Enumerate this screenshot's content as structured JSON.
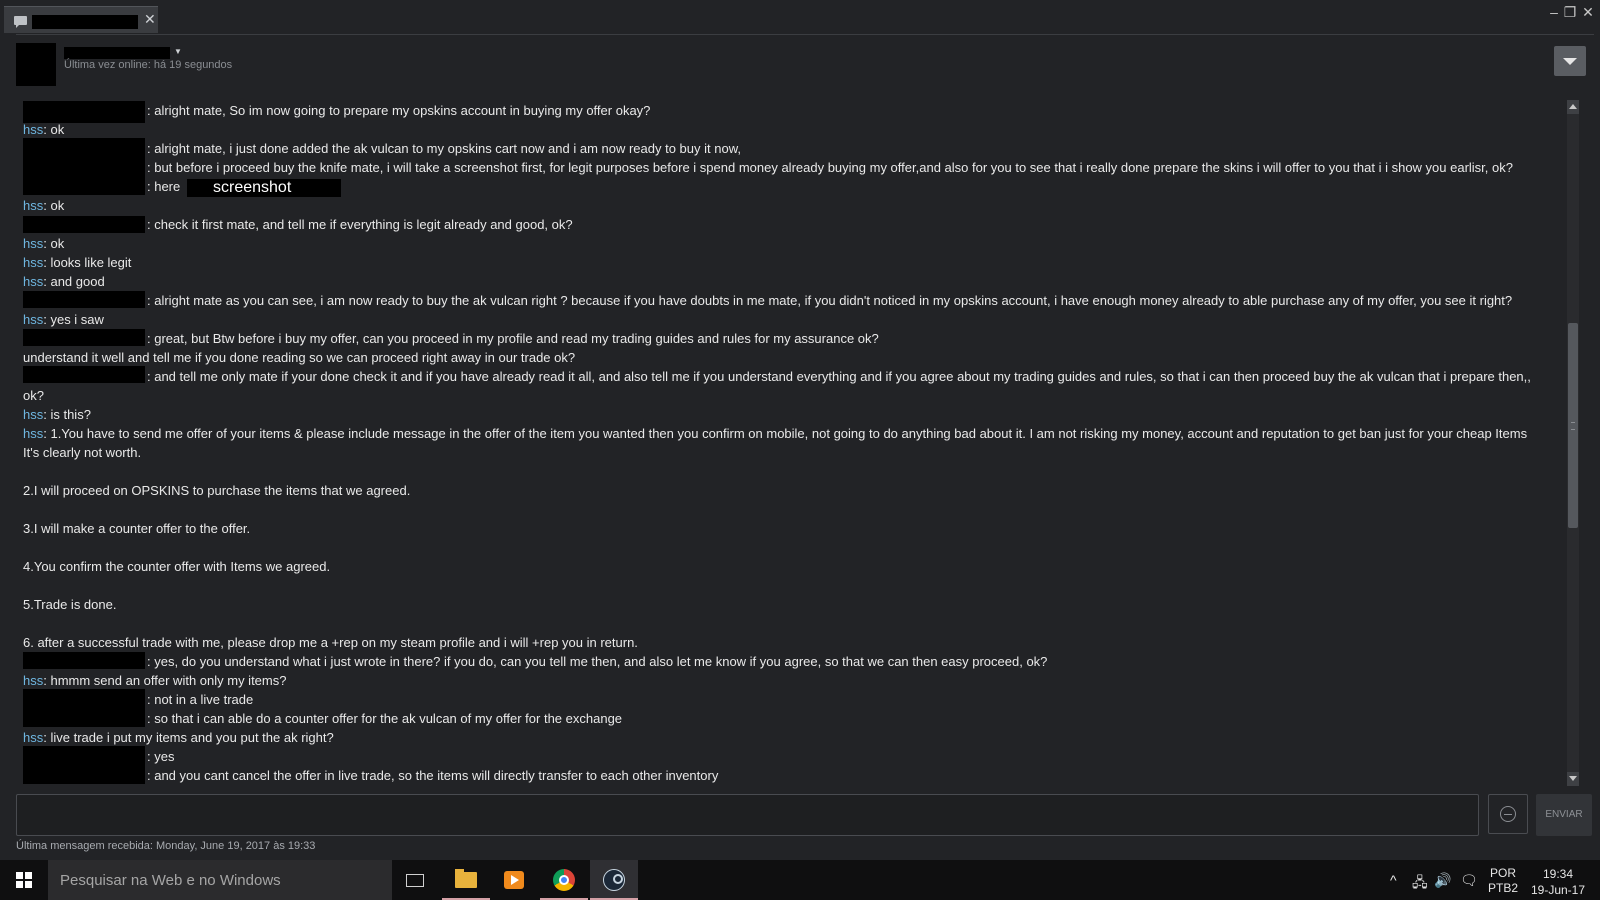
{
  "window": {
    "minimize_glyph": "–",
    "restore_glyph": "❐",
    "close_glyph": "✕",
    "tab_close_glyph": "✕"
  },
  "header": {
    "status": "Última vez online: há 19 segundos",
    "menu_icon": "chevron-down-icon"
  },
  "chat": {
    "screenshot_link": "screenshot",
    "lines": [
      {
        "nick": "",
        "text": ": alright mate,  So im now going to prepare my opskins account in buying my offer okay?"
      },
      {
        "nick": "hss",
        "text": ": ok"
      },
      {
        "nick": "",
        "text": ": alright mate,  i just done added the ak vulcan to my opskins cart now and i am now ready to buy it now,"
      },
      {
        "nick": "",
        "text": ": but before i proceed buy the knife mate,  i will take a screenshot first, for legit purposes before i spend money already buying my offer,and also for you to see that i really done prepare the skins i will offer to you  that i i show you earlisr,  ok?"
      },
      {
        "nick": "",
        "text": ": here"
      },
      {
        "nick": "hss",
        "text": ": ok"
      },
      {
        "nick": "",
        "text": ": check it first mate,  and tell me if everything is legit already and good,  ok?"
      },
      {
        "nick": "hss",
        "text": ": ok"
      },
      {
        "nick": "hss",
        "text": ": looks like legit"
      },
      {
        "nick": "hss",
        "text": ": and good"
      },
      {
        "nick": "",
        "text": ": alright mate  as you can see,  i am now ready to buy the ak vulcan right ?  because if you have doubts in me mate,  if you didn't noticed in my opskins account,  i have enough money already  to able purchase any of my offer,  you see it  right?"
      },
      {
        "nick": "hss",
        "text": ": yes i saw"
      },
      {
        "nick": "",
        "text": ": great,  but Btw before i buy my offer, can you proceed in my profile and read my trading guides and rules for my assurance ok?"
      },
      {
        "nick": "",
        "text": "understand it well and tell me if you done reading so we can proceed right away in our trade ok?"
      },
      {
        "nick": "",
        "text": ": and tell me only mate if your done check it and if you have already read it all,  and also tell me if you understand everything and if you agree about my trading guides and rules,  so that i can then proceed buy the ak vulcan that i prepare then,,"
      },
      {
        "nick": "",
        "text": "ok?"
      },
      {
        "nick": "hss",
        "text": ": is this?"
      },
      {
        "nick": "hss",
        "text": ": 1.You have to send me offer of your items & please include message in the offer of the item you wanted then you confirm on mobile, not going to do anything bad about it. I am not risking my money, account and reputation to get ban just for your cheap Items"
      },
      {
        "nick": "",
        "text": "It's clearly not worth."
      },
      {
        "nick": "",
        "text": "2.I will proceed on OPSKINS to purchase the items that we agreed."
      },
      {
        "nick": "",
        "text": "3.I will make a counter offer to the offer."
      },
      {
        "nick": "",
        "text": "4.You confirm the counter offer with Items we agreed."
      },
      {
        "nick": "",
        "text": "5.Trade is done."
      },
      {
        "nick": "",
        "text": "6. after a successful trade with me, please drop me a +rep on my steam profile and i will +rep you in return."
      },
      {
        "nick": "",
        "text": ": yes,  do you understand  what i just wrote in there?  if you do,  can you tell me then, and also let me know if you agree,  so that we can then easy proceed,  ok?"
      },
      {
        "nick": "hss",
        "text": ": hmmm send an offer with only my items?"
      },
      {
        "nick": "",
        "text": ": not in a live trade"
      },
      {
        "nick": "",
        "text": ": so that i can able do a counter offer  for the ak vulcan of my offer for the exchange"
      },
      {
        "nick": "hss",
        "text": ": live trade i put my items and you put the ak right?"
      },
      {
        "nick": "",
        "text": ": yes"
      },
      {
        "nick": "",
        "text": ": and you cant cancel the offer in live trade,  so the items will directly transfer to each other inventory"
      }
    ]
  },
  "composer": {
    "placeholder": "",
    "send_label": "ENVIAR",
    "emoji_icon": "emoji-icon",
    "last_message": "Última mensagem recebida: Monday, June 19, 2017 às 19:33"
  },
  "taskbar": {
    "search_placeholder": "Pesquisar na Web e no Windows",
    "tray_chevron": "^",
    "tray_network": "🖧",
    "tray_volume": "🔊",
    "tray_notifications": "🗨",
    "lang_line1": "POR",
    "lang_line2": "PTB2",
    "time": "19:34",
    "date": "19-Jun-17"
  },
  "colors": {
    "nick": "#6fb6e0",
    "background": "#222326",
    "taskbar": "#0f0f10"
  }
}
